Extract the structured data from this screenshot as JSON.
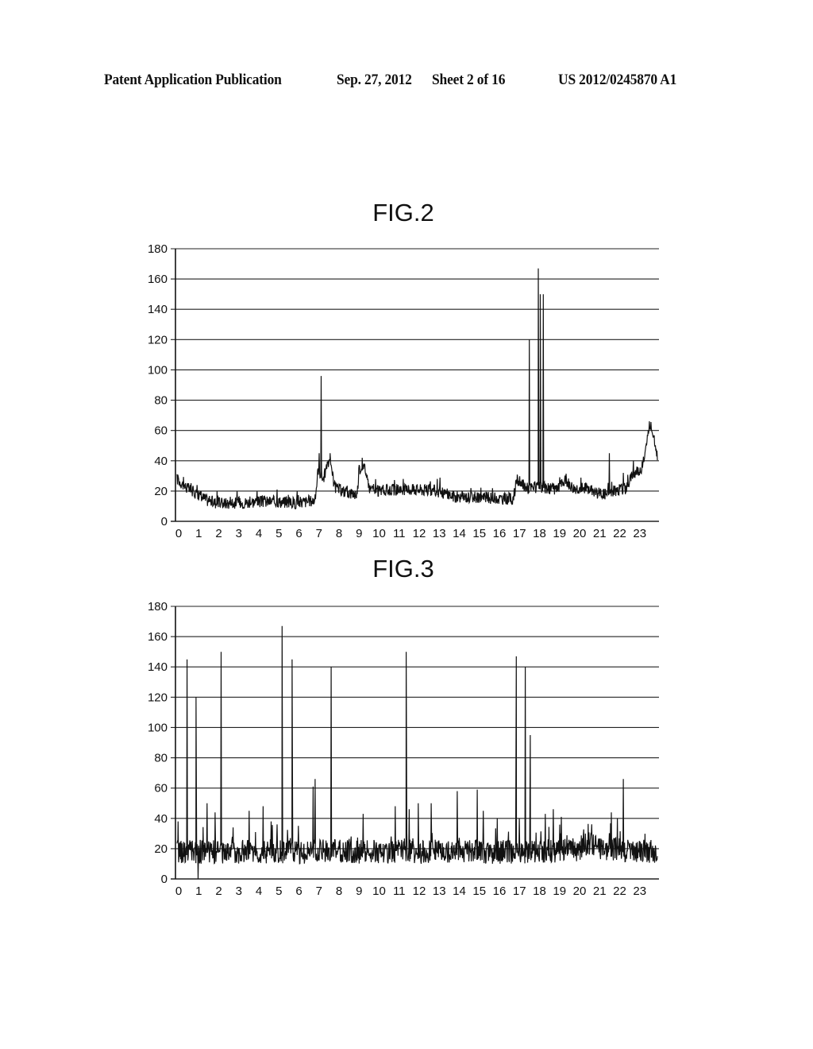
{
  "header": {
    "left": "Patent Application Publication",
    "date": "Sep. 27, 2012",
    "sheet": "Sheet 2 of 16",
    "number": "US 2012/0245870 A1"
  },
  "chart_data": [
    {
      "id": "fig2",
      "type": "line",
      "title": "FIG.2",
      "xlabel": "",
      "ylabel": "",
      "xlim": [
        0,
        24
      ],
      "ylim": [
        0,
        180
      ],
      "grid": true,
      "yticks": [
        0,
        20,
        40,
        60,
        80,
        100,
        120,
        140,
        160,
        180
      ],
      "xticks": [
        0,
        1,
        2,
        3,
        4,
        5,
        6,
        7,
        8,
        9,
        10,
        11,
        12,
        13,
        14,
        15,
        16,
        17,
        18,
        19,
        20,
        21,
        22,
        23
      ],
      "series": [
        {
          "name": "fig2-series",
          "baseline": [
            [
              0,
              28
            ],
            [
              0.5,
              22
            ],
            [
              1,
              18
            ],
            [
              1.5,
              14
            ],
            [
              2,
              12
            ],
            [
              3,
              12
            ],
            [
              4,
              13
            ],
            [
              5,
              13
            ],
            [
              6,
              12
            ],
            [
              6.9,
              14
            ],
            [
              7.05,
              35
            ],
            [
              7.3,
              28
            ],
            [
              7.6,
              40
            ],
            [
              7.9,
              22
            ],
            [
              8.5,
              19
            ],
            [
              9.0,
              18
            ],
            [
              9.1,
              35
            ],
            [
              9.4,
              35
            ],
            [
              9.6,
              22
            ],
            [
              10,
              20
            ],
            [
              11,
              21
            ],
            [
              12,
              21
            ],
            [
              13,
              20
            ],
            [
              13.5,
              18
            ],
            [
              14,
              16
            ],
            [
              15,
              16
            ],
            [
              16,
              15
            ],
            [
              16.8,
              15
            ],
            [
              17.0,
              27
            ],
            [
              17.5,
              22
            ],
            [
              18.5,
              22
            ],
            [
              19,
              21
            ],
            [
              19.4,
              27
            ],
            [
              19.8,
              22
            ],
            [
              20.5,
              22
            ],
            [
              21,
              19
            ],
            [
              21.5,
              18
            ],
            [
              22,
              21
            ],
            [
              22.5,
              22
            ],
            [
              22.8,
              32
            ],
            [
              23.2,
              35
            ],
            [
              23.4,
              45
            ],
            [
              23.6,
              64
            ],
            [
              23.8,
              58
            ],
            [
              24,
              44
            ]
          ],
          "noise": 4,
          "spikes": [
            [
              0.05,
              30
            ],
            [
              1.0,
              24
            ],
            [
              2.0,
              20
            ],
            [
              3.0,
              20
            ],
            [
              4.0,
              20
            ],
            [
              5.0,
              21
            ],
            [
              6.0,
              20
            ],
            [
              7.1,
              45
            ],
            [
              7.2,
              96
            ],
            [
              7.65,
              45
            ],
            [
              9.25,
              42
            ],
            [
              11.3,
              28
            ],
            [
              13.0,
              28
            ],
            [
              17.6,
              120
            ],
            [
              18.05,
              167
            ],
            [
              18.15,
              150
            ],
            [
              18.3,
              150
            ],
            [
              21.6,
              45
            ],
            [
              22.3,
              32
            ],
            [
              22.8,
              40
            ],
            [
              23.6,
              66
            ]
          ]
        }
      ]
    },
    {
      "id": "fig3",
      "type": "line",
      "title": "FIG.3",
      "xlabel": "",
      "ylabel": "",
      "xlim": [
        0,
        24
      ],
      "ylim": [
        0,
        180
      ],
      "grid": true,
      "yticks": [
        0,
        20,
        40,
        60,
        80,
        100,
        120,
        140,
        160,
        180
      ],
      "xticks": [
        0,
        1,
        2,
        3,
        4,
        5,
        6,
        7,
        8,
        9,
        10,
        11,
        12,
        13,
        14,
        15,
        16,
        17,
        18,
        19,
        20,
        21,
        22,
        23
      ],
      "series": [
        {
          "name": "fig3-series",
          "baseline": [
            [
              0,
              18
            ],
            [
              6,
              18
            ],
            [
              12,
              18
            ],
            [
              18,
              18
            ],
            [
              20,
              19
            ],
            [
              20.5,
              24
            ],
            [
              21,
              20
            ],
            [
              24,
              18
            ]
          ],
          "noise": 8,
          "spikes": [
            [
              0.05,
              38
            ],
            [
              0.5,
              145
            ],
            [
              0.95,
              120
            ],
            [
              1.05,
              0
            ],
            [
              1.5,
              50
            ],
            [
              1.9,
              44
            ],
            [
              2.2,
              150
            ],
            [
              2.8,
              34
            ],
            [
              3.6,
              45
            ],
            [
              4.3,
              48
            ],
            [
              4.7,
              38
            ],
            [
              5.0,
              36
            ],
            [
              5.25,
              167
            ],
            [
              5.75,
              145
            ],
            [
              6.8,
              61
            ],
            [
              6.9,
              66
            ],
            [
              7.7,
              140
            ],
            [
              8.7,
              28
            ],
            [
              9.3,
              43
            ],
            [
              10.9,
              48
            ],
            [
              11.45,
              150
            ],
            [
              11.6,
              46
            ],
            [
              12.05,
              50
            ],
            [
              12.7,
              50
            ],
            [
              14.0,
              58
            ],
            [
              15.0,
              59
            ],
            [
              15.3,
              45
            ],
            [
              16.0,
              40
            ],
            [
              16.95,
              147
            ],
            [
              17.1,
              40
            ],
            [
              17.4,
              140
            ],
            [
              17.65,
              95
            ],
            [
              18.4,
              43
            ],
            [
              18.8,
              46
            ],
            [
              19.2,
              41
            ],
            [
              21.7,
              44
            ],
            [
              22.3,
              66
            ],
            [
              22.0,
              40
            ]
          ]
        }
      ]
    }
  ]
}
